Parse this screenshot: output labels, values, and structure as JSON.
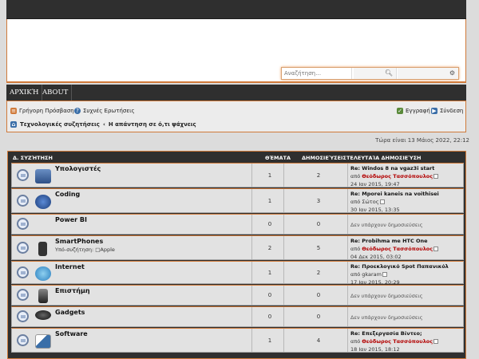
{
  "search": {
    "placeholder": "Αναζήτηση…",
    "search_icon": "magnifier-icon",
    "advanced_icon": "gear-icon"
  },
  "nav": {
    "home": "ΑΡΧΙΚΉ",
    "about": "ABOUT"
  },
  "quicklinks": {
    "quick": "Γρήγορη Πρόσβαση",
    "faq": "Συχνές Ερωτήσεις",
    "register": "Εγγραφή",
    "login": "Σύνδεση"
  },
  "breadcrumbs": {
    "home": "Τεχνολογικές συζητήσεις",
    "sep": "‹",
    "current": "Η απάντηση σε ό,τι ψάχνεις"
  },
  "time": "Τώρα είναι 13 Μάιος 2022, 22:12",
  "table": {
    "header": {
      "forum": "Δ. ΣΥΖΉΤΗΣΗ",
      "topics": "ΘΈΜΑΤΑ",
      "posts": "ΔΗΜΟΣΙΕΎΣΕΙΣ",
      "last": "ΤΕΛΕΥΤΑΊΑ ΔΗΜΟΣΙΕΎΣΗ"
    },
    "by": "από",
    "rows": [
      {
        "title": "Υπολογιστές",
        "topics": "1",
        "posts": "2",
        "last_title": "Re: Windos 8 na vgaz3i start",
        "last_by": "Θεόδωρος Τασσόπουλος",
        "last_date": "24 Ιαν 2015, 19:47",
        "img": "computer-icon"
      },
      {
        "title": "Coding",
        "topics": "1",
        "posts": "3",
        "last_title": "Re: Mporei kaneis na voithisei",
        "last_by": "Σώτος",
        "last_date": "30 Ιαν 2015, 13:35",
        "img": "html-icon"
      },
      {
        "title": "Power BI",
        "topics": "0",
        "posts": "0",
        "last_none": "Δεν υπάρχουν δημοσιεύσεις"
      },
      {
        "title": "SmartPhones",
        "subforum_label": "Υπό-συζήτηση:",
        "subforum": "Apple",
        "topics": "2",
        "posts": "5",
        "last_title": "Re: Probihma me HTC One",
        "last_by": "Θεόδωρος Τασσόπουλος",
        "last_date": "04 Δεκ 2015, 03:02",
        "img": "smartphone-icon"
      },
      {
        "title": "Internet",
        "topics": "1",
        "posts": "2",
        "last_title": "Re: Προεκλογικό Spot Παπανικόλ",
        "last_by": "gkaram",
        "last_date": "17 Ιαν 2015, 20:29",
        "img": "globe-icon"
      },
      {
        "title": "Επιστήμη",
        "topics": "0",
        "posts": "0",
        "last_none": "Δεν υπάρχουν δημοσιεύσεις",
        "img": "microscope-icon"
      },
      {
        "title": "Gadgets",
        "topics": "0",
        "posts": "0",
        "last_none": "Δεν υπάρχουν δημοσιεύσεις",
        "img": "mouse-icon"
      },
      {
        "title": "Software",
        "topics": "1",
        "posts": "4",
        "last_title": "Re: Επεξεργασία Βίντεο;",
        "last_by": "Θεόδωρος Τασσόπουλος",
        "last_date": "18 Ιαν 2015, 18:12",
        "img": "software-icon"
      }
    ]
  }
}
